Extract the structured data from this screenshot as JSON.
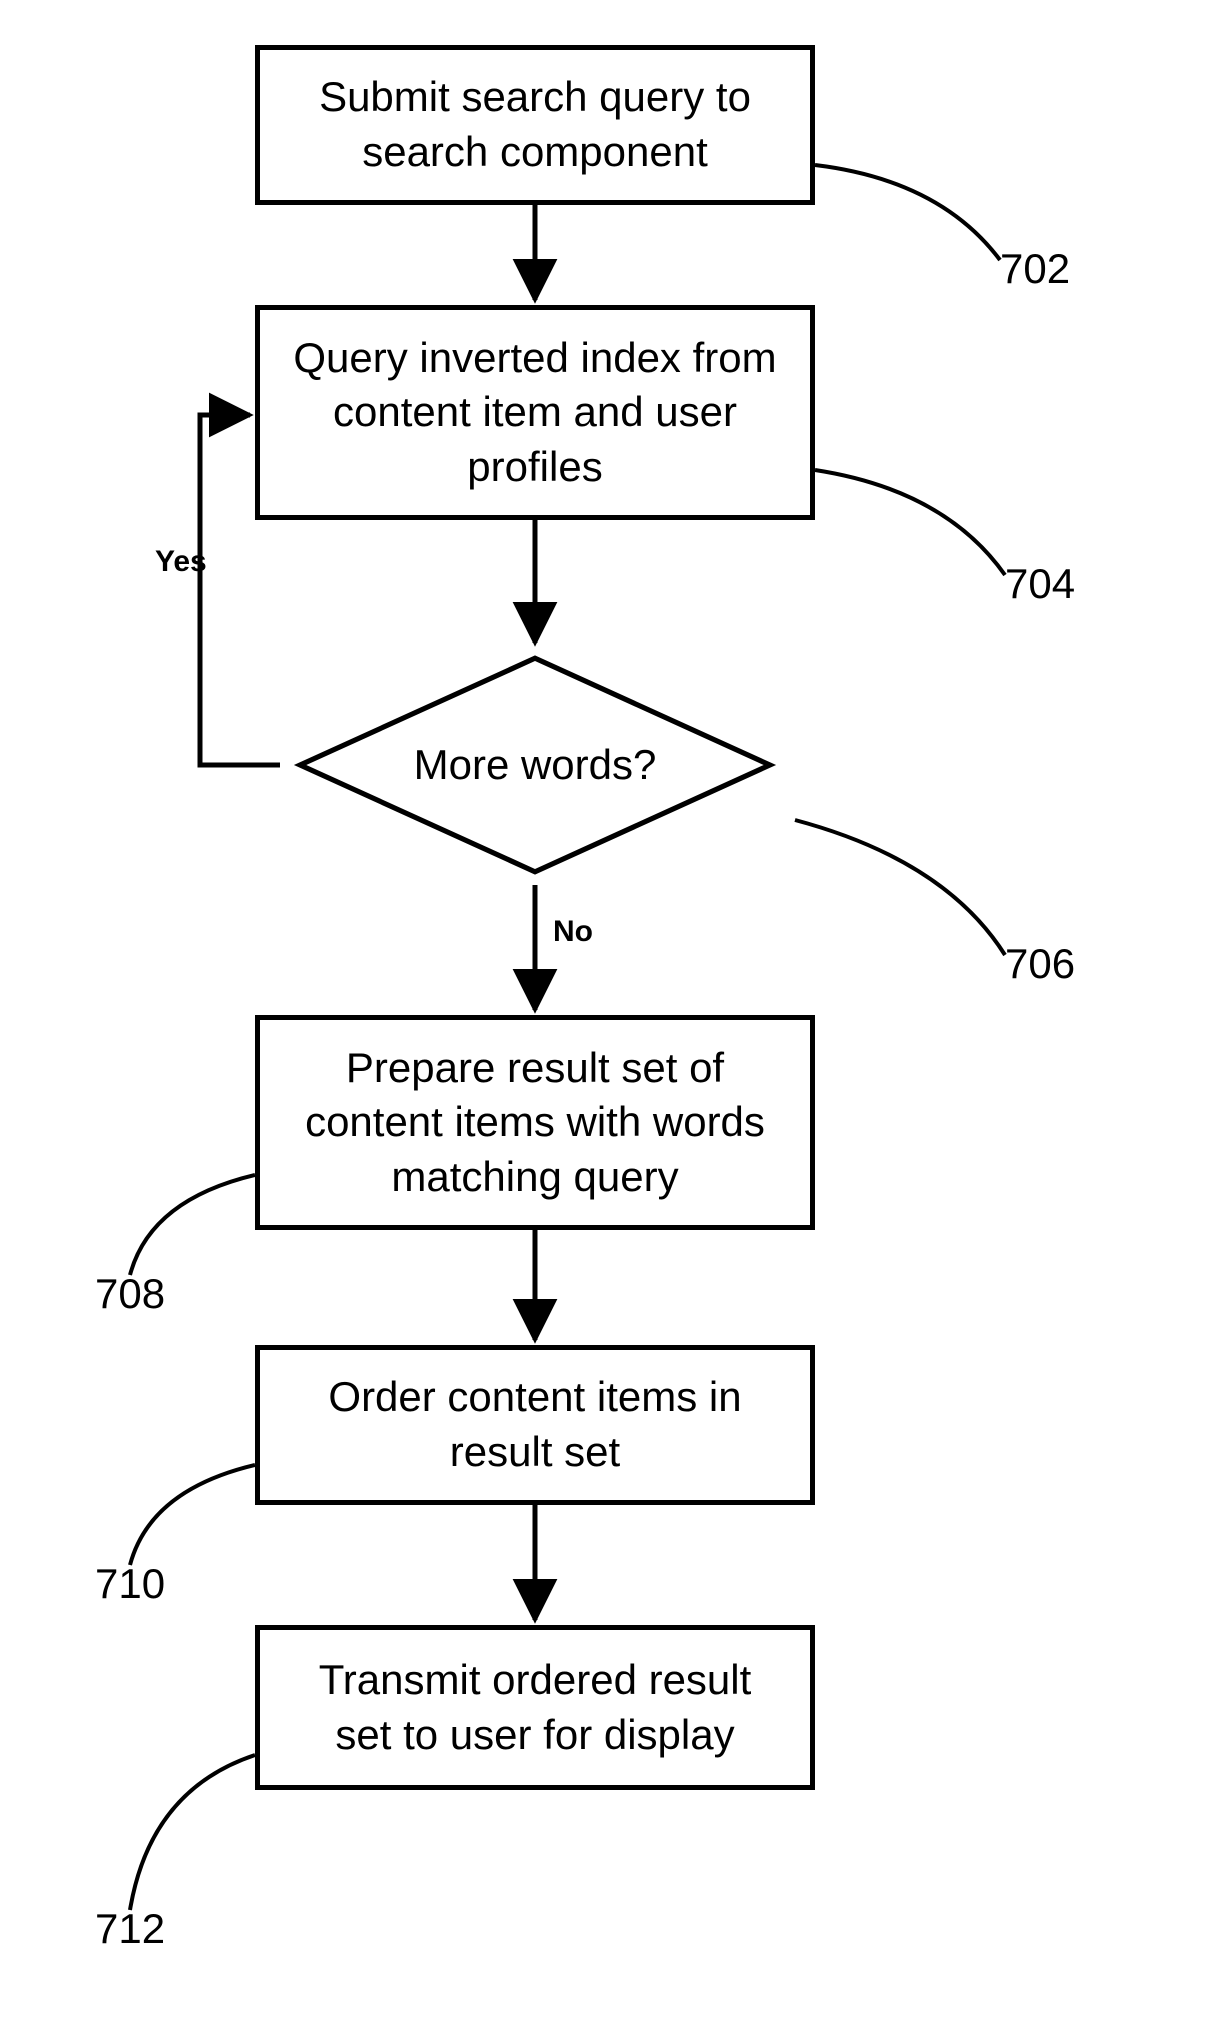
{
  "nodes": {
    "n702": {
      "text": "Submit search query to search component",
      "ref": "702"
    },
    "n704": {
      "text": "Query inverted index from content item and user profiles",
      "ref": "704"
    },
    "n706": {
      "text": "More words?",
      "ref": "706"
    },
    "n708": {
      "text": "Prepare result set of content items with words matching query",
      "ref": "708"
    },
    "n710": {
      "text": "Order content items in result set",
      "ref": "710"
    },
    "n712": {
      "text": "Transmit ordered result set to user for display",
      "ref": "712"
    }
  },
  "edge_labels": {
    "yes": "Yes",
    "no": "No"
  }
}
